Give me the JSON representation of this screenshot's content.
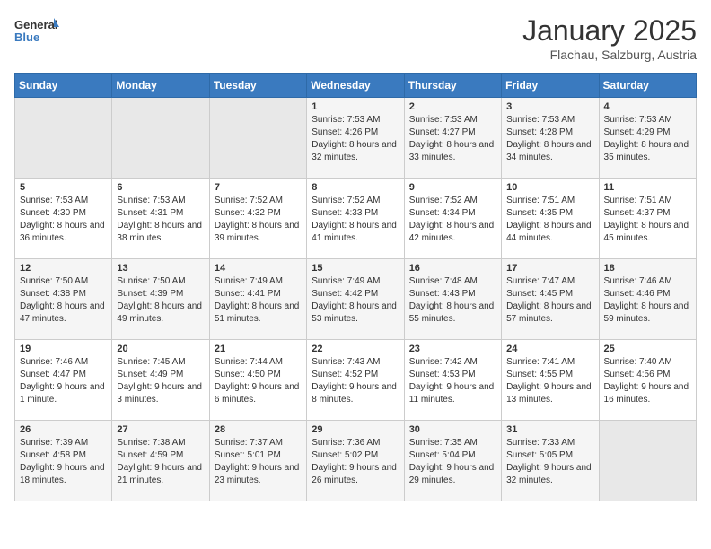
{
  "header": {
    "logo_line1": "General",
    "logo_line2": "Blue",
    "title": "January 2025",
    "subtitle": "Flachau, Salzburg, Austria"
  },
  "weekdays": [
    "Sunday",
    "Monday",
    "Tuesday",
    "Wednesday",
    "Thursday",
    "Friday",
    "Saturday"
  ],
  "weeks": [
    [
      {
        "day": "",
        "sunrise": "",
        "sunset": "",
        "daylight": ""
      },
      {
        "day": "",
        "sunrise": "",
        "sunset": "",
        "daylight": ""
      },
      {
        "day": "",
        "sunrise": "",
        "sunset": "",
        "daylight": ""
      },
      {
        "day": "1",
        "sunrise": "Sunrise: 7:53 AM",
        "sunset": "Sunset: 4:26 PM",
        "daylight": "Daylight: 8 hours and 32 minutes."
      },
      {
        "day": "2",
        "sunrise": "Sunrise: 7:53 AM",
        "sunset": "Sunset: 4:27 PM",
        "daylight": "Daylight: 8 hours and 33 minutes."
      },
      {
        "day": "3",
        "sunrise": "Sunrise: 7:53 AM",
        "sunset": "Sunset: 4:28 PM",
        "daylight": "Daylight: 8 hours and 34 minutes."
      },
      {
        "day": "4",
        "sunrise": "Sunrise: 7:53 AM",
        "sunset": "Sunset: 4:29 PM",
        "daylight": "Daylight: 8 hours and 35 minutes."
      }
    ],
    [
      {
        "day": "5",
        "sunrise": "Sunrise: 7:53 AM",
        "sunset": "Sunset: 4:30 PM",
        "daylight": "Daylight: 8 hours and 36 minutes."
      },
      {
        "day": "6",
        "sunrise": "Sunrise: 7:53 AM",
        "sunset": "Sunset: 4:31 PM",
        "daylight": "Daylight: 8 hours and 38 minutes."
      },
      {
        "day": "7",
        "sunrise": "Sunrise: 7:52 AM",
        "sunset": "Sunset: 4:32 PM",
        "daylight": "Daylight: 8 hours and 39 minutes."
      },
      {
        "day": "8",
        "sunrise": "Sunrise: 7:52 AM",
        "sunset": "Sunset: 4:33 PM",
        "daylight": "Daylight: 8 hours and 41 minutes."
      },
      {
        "day": "9",
        "sunrise": "Sunrise: 7:52 AM",
        "sunset": "Sunset: 4:34 PM",
        "daylight": "Daylight: 8 hours and 42 minutes."
      },
      {
        "day": "10",
        "sunrise": "Sunrise: 7:51 AM",
        "sunset": "Sunset: 4:35 PM",
        "daylight": "Daylight: 8 hours and 44 minutes."
      },
      {
        "day": "11",
        "sunrise": "Sunrise: 7:51 AM",
        "sunset": "Sunset: 4:37 PM",
        "daylight": "Daylight: 8 hours and 45 minutes."
      }
    ],
    [
      {
        "day": "12",
        "sunrise": "Sunrise: 7:50 AM",
        "sunset": "Sunset: 4:38 PM",
        "daylight": "Daylight: 8 hours and 47 minutes."
      },
      {
        "day": "13",
        "sunrise": "Sunrise: 7:50 AM",
        "sunset": "Sunset: 4:39 PM",
        "daylight": "Daylight: 8 hours and 49 minutes."
      },
      {
        "day": "14",
        "sunrise": "Sunrise: 7:49 AM",
        "sunset": "Sunset: 4:41 PM",
        "daylight": "Daylight: 8 hours and 51 minutes."
      },
      {
        "day": "15",
        "sunrise": "Sunrise: 7:49 AM",
        "sunset": "Sunset: 4:42 PM",
        "daylight": "Daylight: 8 hours and 53 minutes."
      },
      {
        "day": "16",
        "sunrise": "Sunrise: 7:48 AM",
        "sunset": "Sunset: 4:43 PM",
        "daylight": "Daylight: 8 hours and 55 minutes."
      },
      {
        "day": "17",
        "sunrise": "Sunrise: 7:47 AM",
        "sunset": "Sunset: 4:45 PM",
        "daylight": "Daylight: 8 hours and 57 minutes."
      },
      {
        "day": "18",
        "sunrise": "Sunrise: 7:46 AM",
        "sunset": "Sunset: 4:46 PM",
        "daylight": "Daylight: 8 hours and 59 minutes."
      }
    ],
    [
      {
        "day": "19",
        "sunrise": "Sunrise: 7:46 AM",
        "sunset": "Sunset: 4:47 PM",
        "daylight": "Daylight: 9 hours and 1 minute."
      },
      {
        "day": "20",
        "sunrise": "Sunrise: 7:45 AM",
        "sunset": "Sunset: 4:49 PM",
        "daylight": "Daylight: 9 hours and 3 minutes."
      },
      {
        "day": "21",
        "sunrise": "Sunrise: 7:44 AM",
        "sunset": "Sunset: 4:50 PM",
        "daylight": "Daylight: 9 hours and 6 minutes."
      },
      {
        "day": "22",
        "sunrise": "Sunrise: 7:43 AM",
        "sunset": "Sunset: 4:52 PM",
        "daylight": "Daylight: 9 hours and 8 minutes."
      },
      {
        "day": "23",
        "sunrise": "Sunrise: 7:42 AM",
        "sunset": "Sunset: 4:53 PM",
        "daylight": "Daylight: 9 hours and 11 minutes."
      },
      {
        "day": "24",
        "sunrise": "Sunrise: 7:41 AM",
        "sunset": "Sunset: 4:55 PM",
        "daylight": "Daylight: 9 hours and 13 minutes."
      },
      {
        "day": "25",
        "sunrise": "Sunrise: 7:40 AM",
        "sunset": "Sunset: 4:56 PM",
        "daylight": "Daylight: 9 hours and 16 minutes."
      }
    ],
    [
      {
        "day": "26",
        "sunrise": "Sunrise: 7:39 AM",
        "sunset": "Sunset: 4:58 PM",
        "daylight": "Daylight: 9 hours and 18 minutes."
      },
      {
        "day": "27",
        "sunrise": "Sunrise: 7:38 AM",
        "sunset": "Sunset: 4:59 PM",
        "daylight": "Daylight: 9 hours and 21 minutes."
      },
      {
        "day": "28",
        "sunrise": "Sunrise: 7:37 AM",
        "sunset": "Sunset: 5:01 PM",
        "daylight": "Daylight: 9 hours and 23 minutes."
      },
      {
        "day": "29",
        "sunrise": "Sunrise: 7:36 AM",
        "sunset": "Sunset: 5:02 PM",
        "daylight": "Daylight: 9 hours and 26 minutes."
      },
      {
        "day": "30",
        "sunrise": "Sunrise: 7:35 AM",
        "sunset": "Sunset: 5:04 PM",
        "daylight": "Daylight: 9 hours and 29 minutes."
      },
      {
        "day": "31",
        "sunrise": "Sunrise: 7:33 AM",
        "sunset": "Sunset: 5:05 PM",
        "daylight": "Daylight: 9 hours and 32 minutes."
      },
      {
        "day": "",
        "sunrise": "",
        "sunset": "",
        "daylight": ""
      }
    ]
  ]
}
